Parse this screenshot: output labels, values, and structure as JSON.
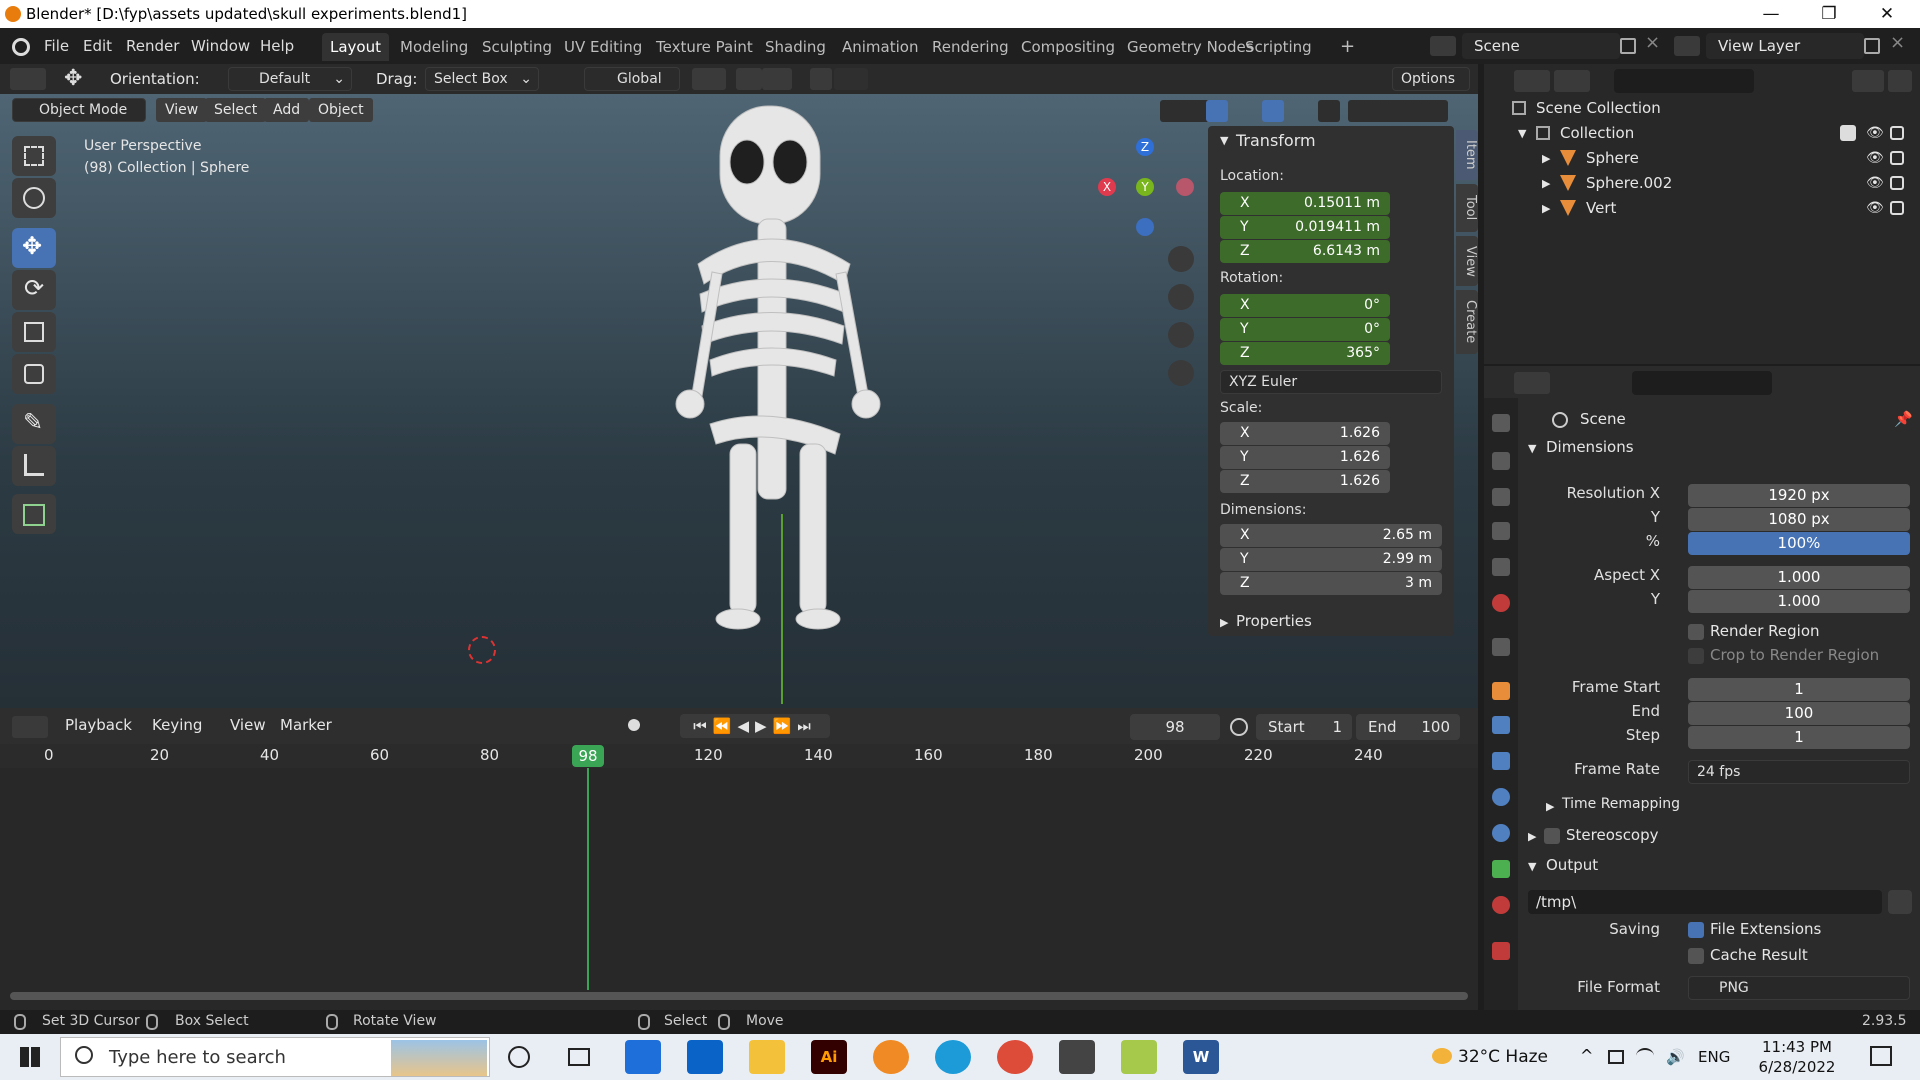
{
  "window": {
    "title": "Blender* [D:\\fyp\\assets updated\\skull experiments.blend1]",
    "min": "—",
    "max": "❐",
    "close": "✕"
  },
  "menu": [
    "File",
    "Edit",
    "Render",
    "Window",
    "Help"
  ],
  "workspaces": [
    "Layout",
    "Modeling",
    "Sculpting",
    "UV Editing",
    "Texture Paint",
    "Shading",
    "Animation",
    "Rendering",
    "Compositing",
    "Geometry Nodes",
    "Scripting"
  ],
  "workspace_add": "+",
  "scene": {
    "name": "Scene",
    "view_layer": "View Layer"
  },
  "toolheader": {
    "orientation_label": "Orientation:",
    "orientation_value": "Default",
    "drag_label": "Drag:",
    "drag_value": "Select Box",
    "transform": "Global",
    "options": "Options"
  },
  "viewport_header": {
    "mode": "Object Mode",
    "view": "View",
    "select": "Select",
    "add": "Add",
    "object": "Object"
  },
  "viewport": {
    "perspective": "User Perspective",
    "collection_info": "(98) Collection | Sphere"
  },
  "gizmo": {
    "x": "X",
    "y": "Y",
    "z": "Z"
  },
  "npanel": {
    "title": "Transform",
    "location_label": "Location:",
    "location": [
      {
        "axis": "X",
        "value": "0.15011 m"
      },
      {
        "axis": "Y",
        "value": "0.019411 m"
      },
      {
        "axis": "Z",
        "value": "6.6143 m"
      }
    ],
    "rotation_label": "Rotation:",
    "rotation": [
      {
        "axis": "X",
        "value": "0°"
      },
      {
        "axis": "Y",
        "value": "0°"
      },
      {
        "axis": "Z",
        "value": "365°"
      }
    ],
    "rotation_mode": "XYZ Euler",
    "scale_label": "Scale:",
    "scale": [
      {
        "axis": "X",
        "value": "1.626"
      },
      {
        "axis": "Y",
        "value": "1.626"
      },
      {
        "axis": "Z",
        "value": "1.626"
      }
    ],
    "dimensions_label": "Dimensions:",
    "dimensions": [
      {
        "axis": "X",
        "value": "2.65 m"
      },
      {
        "axis": "Y",
        "value": "2.99 m"
      },
      {
        "axis": "Z",
        "value": "3 m"
      }
    ],
    "properties": "Properties",
    "tabs": [
      "Item",
      "Tool",
      "View",
      "Create"
    ]
  },
  "timeline": {
    "playback": "Playback",
    "keying": "Keying",
    "view": "View",
    "marker": "Marker",
    "current_frame": "98",
    "start_label": "Start",
    "start": "1",
    "end_label": "End",
    "end": "100",
    "ticks": [
      "0",
      "20",
      "40",
      "60",
      "80",
      "120",
      "140",
      "160",
      "180",
      "200",
      "220",
      "240"
    ],
    "cursor_label": "98"
  },
  "outliner": {
    "scene_collection": "Scene Collection",
    "collection": "Collection",
    "items": [
      "Sphere",
      "Sphere.002",
      "Vert"
    ]
  },
  "properties": {
    "context": "Scene",
    "dimensions": "Dimensions",
    "resolution_x_label": "Resolution X",
    "resolution_x": "1920 px",
    "y_label": "Y",
    "resolution_y": "1080 px",
    "percent_label": "%",
    "percent": "100%",
    "aspect_x_label": "Aspect X",
    "aspect_x": "1.000",
    "aspect_y": "1.000",
    "render_region": "Render Region",
    "crop": "Crop to Render Region",
    "frame_start_label": "Frame Start",
    "frame_start": "1",
    "end_label": "End",
    "frame_end": "100",
    "step_label": "Step",
    "step": "1",
    "frame_rate_label": "Frame Rate",
    "frame_rate": "24 fps",
    "time_remapping": "Time Remapping",
    "stereoscopy": "Stereoscopy",
    "output": "Output",
    "path": "/tmp\\",
    "saving_label": "Saving",
    "file_extensions": "File Extensions",
    "cache_result": "Cache Result",
    "file_format_label": "File Format",
    "file_format": "PNG"
  },
  "status": {
    "set_cursor": "Set 3D Cursor",
    "box_select": "Box Select",
    "rotate_view": "Rotate View",
    "select": "Select",
    "move": "Move",
    "version": "2.93.5"
  },
  "taskbar": {
    "search_placeholder": "Type here to search",
    "weather": "32°C  Haze",
    "lang": "ENG",
    "time": "11:43 PM",
    "date": "6/28/2022",
    "ai": "Ai",
    "word": "W"
  },
  "colors": {
    "accent": "#4772b3",
    "green_field": "#3d6b29",
    "frame_cursor": "#3aa655"
  }
}
